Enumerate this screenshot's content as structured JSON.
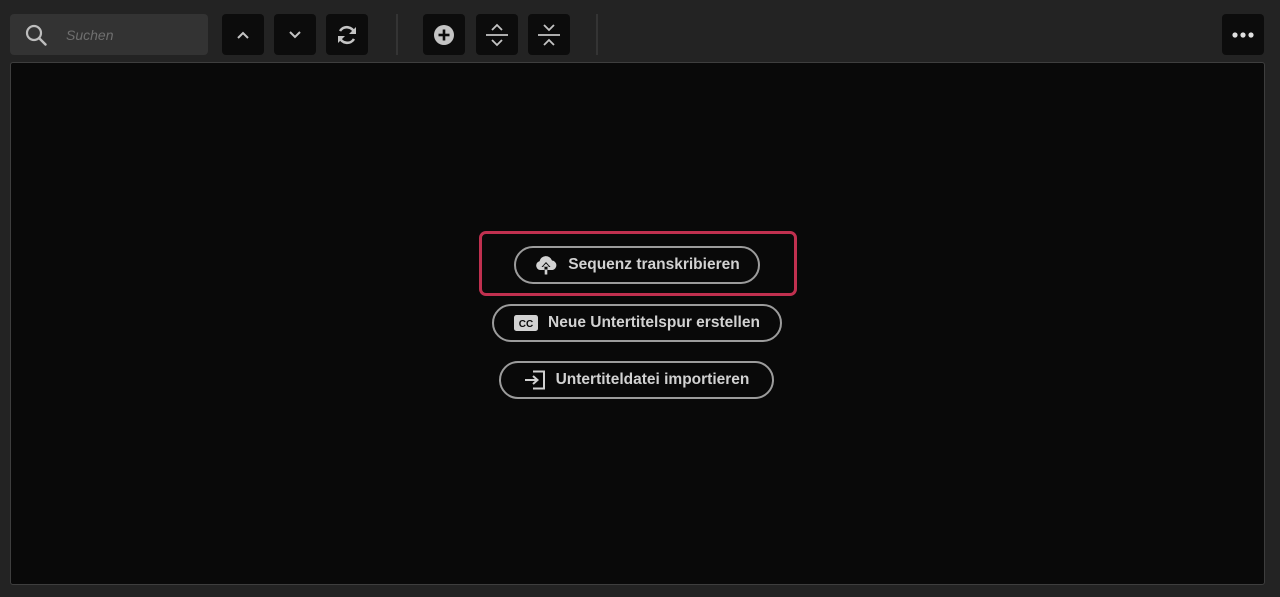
{
  "search": {
    "placeholder": "Suchen",
    "value": ""
  },
  "toolbar": {
    "buttons": [
      {
        "name": "previous",
        "icon": "chevron-up-icon"
      },
      {
        "name": "next",
        "icon": "chevron-down-icon"
      },
      {
        "name": "refresh",
        "icon": "refresh-icon"
      },
      {
        "name": "add",
        "icon": "plus-circle-icon"
      },
      {
        "name": "expand-all",
        "icon": "expand-vertical-icon"
      },
      {
        "name": "collapse-all",
        "icon": "collapse-vertical-icon"
      },
      {
        "name": "more",
        "icon": "more-horizontal-icon"
      }
    ]
  },
  "actions": {
    "transcribe": {
      "label": "Sequenz transkribieren",
      "icon": "cloud-upload-icon"
    },
    "new_track": {
      "label": "Neue Untertitelspur erstellen",
      "icon": "cc-icon"
    },
    "import": {
      "label": "Untertiteldatei importieren",
      "icon": "import-icon"
    }
  },
  "colors": {
    "background": "#232323",
    "panel": "#090909",
    "highlight": "#c0304f",
    "pill_border": "#9c9c9c",
    "text": "#d2d2d2"
  }
}
